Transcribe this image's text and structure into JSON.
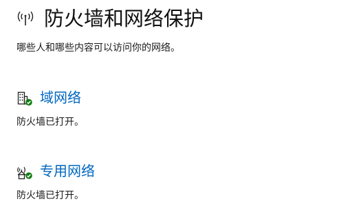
{
  "page": {
    "title": "防火墙和网络保护",
    "subtitle": "哪些人和哪些内容可以访问你的网络。",
    "header_icon": "wifi-antenna-icon"
  },
  "networks": [
    {
      "icon": "domain-building-icon",
      "name": "域网络",
      "status": "防火墙已打开。",
      "status_color": "#107c10"
    },
    {
      "icon": "private-home-network-icon",
      "name": "专用网络",
      "status": "防火墙已打开。",
      "status_color": "#107c10"
    }
  ],
  "colors": {
    "link": "#0067c0",
    "check_badge": "#107c10"
  }
}
